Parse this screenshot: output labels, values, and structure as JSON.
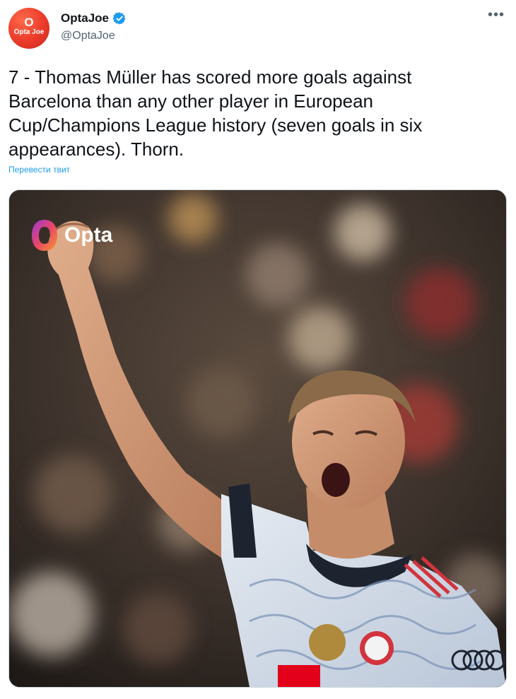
{
  "author": {
    "avatar_top": "O",
    "avatar_word": "Opta Joe",
    "display_name": "OptaJoe",
    "handle": "@OptaJoe",
    "verified_icon": "verified-badge-icon",
    "verified_color": "#1d9bf0"
  },
  "menu": {
    "more_label": "•••"
  },
  "tweet": {
    "text": "7 - Thomas Müller has scored more goals against\nBarcelona than any other player in European\nCup/Champions League history (seven goals in six\nappearances). Thorn.",
    "translate_label": "Перевести твит"
  },
  "media": {
    "watermark_text": "Opta",
    "watermark_icon": "opta-logo-icon",
    "photo_subject": "football-player-celebrating-photo"
  },
  "colors": {
    "link": "#1d9bf0",
    "text": "#0f1419",
    "secondary": "#536471",
    "avatar": "#ea3a2a"
  }
}
